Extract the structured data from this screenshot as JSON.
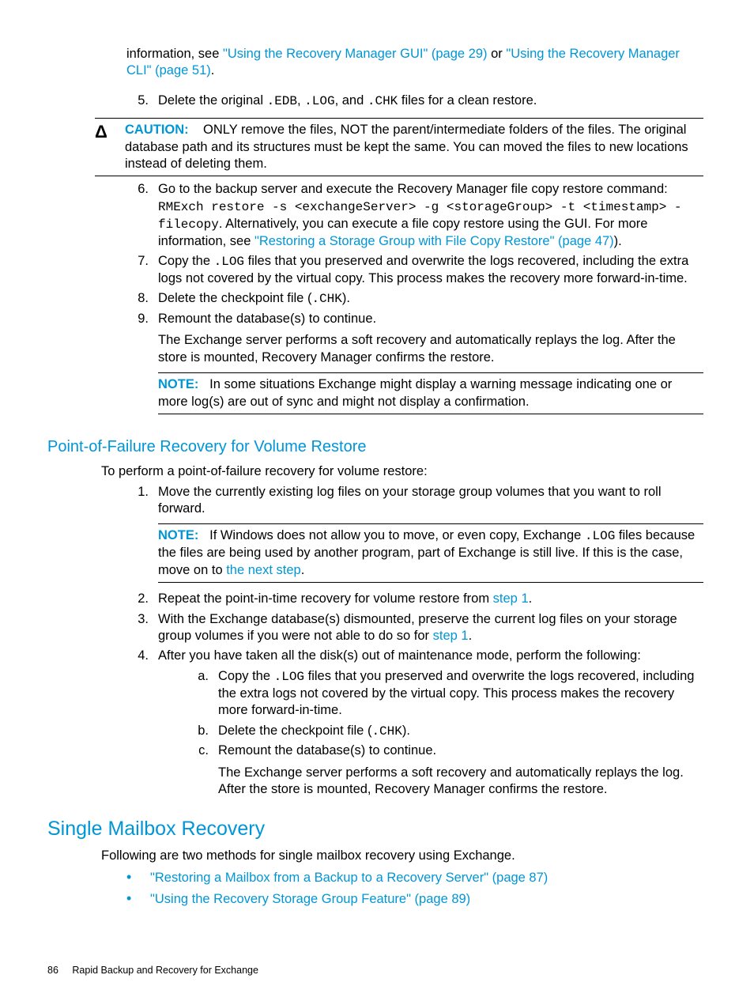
{
  "p1": {
    "t1": "information, see ",
    "l1": "\"Using the Recovery Manager GUI\" (page 29)",
    "t2": " or ",
    "l2": "\"Using the Recovery Manager CLI\" (page 51)",
    "t3": "."
  },
  "i5": {
    "num": "5.",
    "t1": "Delete the original ",
    "c1": ".EDB",
    "t2": ", ",
    "c2": ".LOG",
    "t3": ", and ",
    "c3": ".CHK",
    "t4": " files for a clean restore."
  },
  "caution": {
    "icon": "Δ",
    "label": "CAUTION:",
    "text": "ONLY remove the files, NOT the parent/intermediate folders of the files. The original database path and its structures must be kept the same. You can moved the files to new locations instead of deleting them."
  },
  "i6": {
    "num": "6.",
    "t1": "Go to the backup server and execute the Recovery Manager file copy restore command: ",
    "c1": "RMExch restore -s <exchangeServer> -g <storageGroup> -t <timestamp> -filecopy",
    "t2": ". Alternatively, you can execute a file copy restore using the GUI. For more information, see ",
    "l1": "\"Restoring a Storage Group with File Copy Restore\" (page 47)",
    "t3": ")."
  },
  "i7": {
    "num": "7.",
    "t1": "Copy the ",
    "c1": ".LOG",
    "t2": " files that you preserved and overwrite the logs recovered, including the extra logs not covered by the virtual copy. This process makes the recovery more forward-in-time."
  },
  "i8": {
    "num": "8.",
    "t1": "Delete the checkpoint file (",
    "c1": ".CHK",
    "t2": ")."
  },
  "i9": {
    "num": "9.",
    "t1": "Remount the database(s) to continue.",
    "p2": "The Exchange server performs a soft recovery and automatically replays the log. After the store is mounted, Recovery Manager confirms the restore."
  },
  "note1": {
    "label": "NOTE:",
    "text": "In some situations Exchange might display a warning message indicating one or more log(s) are out of sync and might not display a confirmation."
  },
  "sec2_h": "Point-of-Failure Recovery for Volume Restore",
  "sec2_intro": "To perform a point-of-failure recovery for volume restore:",
  "v1": {
    "num": "1.",
    "t1": "Move the currently existing log files on your storage group volumes that you want to roll forward."
  },
  "note2": {
    "label": "NOTE:",
    "t1": "If Windows does not allow you to move, or even copy, Exchange ",
    "c1": ".LOG",
    "t2": " files because the files are being used by another program, part of Exchange is still live. If this is the case, move on to ",
    "l1": "the next step",
    "t3": "."
  },
  "v2": {
    "num": "2.",
    "t1": "Repeat the point-in-time recovery for volume restore from ",
    "l1": "step 1",
    "t2": "."
  },
  "v3": {
    "num": "3.",
    "t1": "With the Exchange database(s) dismounted, preserve the current log files on your storage group volumes if you were not able to do so for ",
    "l1": "step 1",
    "t2": "."
  },
  "v4": {
    "num": "4.",
    "t1": "After you have taken all the disk(s) out of maintenance mode, perform the following:",
    "a": {
      "num": "a.",
      "t1": "Copy the ",
      "c1": ".LOG",
      "t2": " files that you preserved and overwrite the logs recovered, including the extra logs not covered by the virtual copy. This process makes the recovery more forward-in-time."
    },
    "b": {
      "num": "b.",
      "t1": "Delete the checkpoint file (",
      "c1": ".CHK",
      "t2": ")."
    },
    "c": {
      "num": "c.",
      "t1": "Remount the database(s) to continue.",
      "p2": "The Exchange server performs a soft recovery and automatically replays the log. After the store is mounted, Recovery Manager confirms the restore."
    }
  },
  "sec3_h": "Single Mailbox Recovery",
  "sec3_intro": "Following are two methods for single mailbox recovery using Exchange.",
  "b1": "\"Restoring a Mailbox from a Backup to a Recovery Server\" (page 87)",
  "b2": "\"Using the Recovery Storage Group Feature\" (page 89)",
  "footer": {
    "num": "86",
    "title": "Rapid Backup and Recovery for Exchange"
  }
}
